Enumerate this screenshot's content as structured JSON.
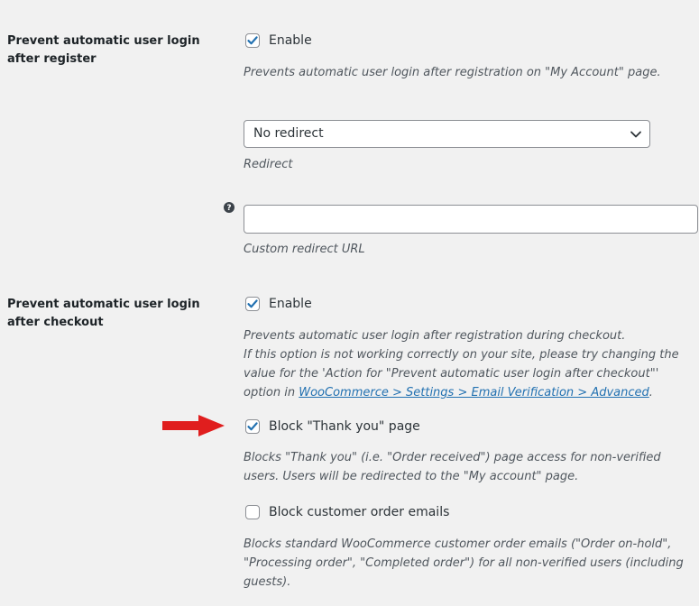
{
  "section_register": {
    "label_line1": "Prevent automatic user login",
    "label_line2": "after register",
    "enable_label": "Enable",
    "enable_checked": true,
    "description": "Prevents automatic user login after registration on \"My Account\" page."
  },
  "redirect": {
    "selected": "No redirect",
    "label": "Redirect"
  },
  "custom_redirect": {
    "value": "",
    "label": "Custom redirect URL",
    "help_icon": "question-circle-icon"
  },
  "section_checkout": {
    "label_line1": "Prevent automatic user login",
    "label_line2": "after checkout",
    "enable_label": "Enable",
    "enable_checked": true,
    "desc_line1": "Prevents automatic user login after registration during checkout.",
    "desc_line2": "If this option is not working correctly on your site, please try changing the",
    "desc_line3": "value for the 'Action for \"Prevent automatic user login after checkout\"'",
    "desc_line4_prefix": "option in ",
    "desc_link": "WooCommerce > Settings > Email Verification > Advanced",
    "desc_line4_suffix": "."
  },
  "block_thank_you": {
    "label": "Block \"Thank you\" page",
    "checked": true,
    "desc_line1": "Blocks \"Thank you\" (i.e. \"Order received\") page access for non-verified",
    "desc_line2": "users. Users will be redirected to the \"My account\" page."
  },
  "block_emails": {
    "label": "Block customer order emails",
    "checked": false,
    "desc_line1": "Blocks standard WooCommerce customer order emails (\"Order on-hold\",",
    "desc_line2": "\"Processing order\", \"Completed order\") for all non-verified users (including",
    "desc_line3": "guests)."
  },
  "colors": {
    "checkmark": "#2271b1",
    "link": "#2271b1",
    "arrow": "#e01e1e",
    "background": "#f1f1f1"
  }
}
